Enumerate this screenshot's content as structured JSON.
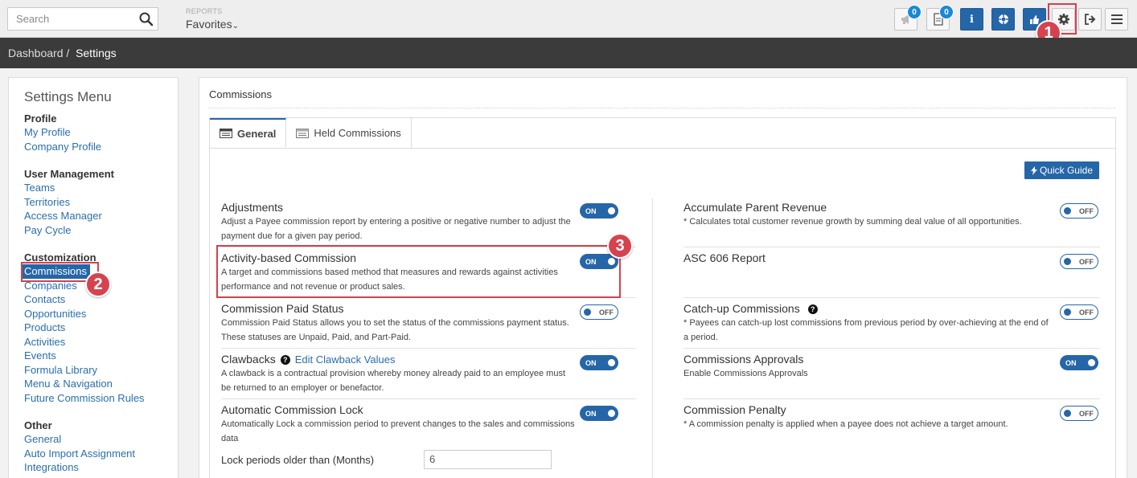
{
  "topbar": {
    "search_placeholder": "Search",
    "reports_label": "REPORTS",
    "favorites_label": "Favorites",
    "announcements_count": "0",
    "documents_count": "0"
  },
  "breadcrumb": {
    "root": "Dashboard",
    "sep": "/",
    "current": "Settings"
  },
  "sidebar": {
    "title": "Settings Menu",
    "groups": [
      {
        "title": "Profile",
        "items": [
          "My Profile",
          "Company Profile"
        ]
      },
      {
        "title": "User Management",
        "items": [
          "Teams",
          "Territories",
          "Access Manager",
          "Pay Cycle"
        ]
      },
      {
        "title": "Customization",
        "items": [
          "Commissions",
          "Companies",
          "Contacts",
          "Opportunities",
          "Products",
          "Activities",
          "Events",
          "Formula Library",
          "Menu & Navigation",
          "Future Commission Rules"
        ]
      },
      {
        "title": "Other",
        "items": [
          "General",
          "Auto Import Assignment",
          "Integrations"
        ]
      }
    ]
  },
  "main": {
    "title": "Commissions",
    "tabs": [
      "General",
      "Held Commissions"
    ],
    "quick_guide": "Quick Guide"
  },
  "settings_left": [
    {
      "title": "Adjustments",
      "desc": "Adjust a Payee commission report by entering a positive or negative number to adjust the payment due for a given pay period.",
      "state": "ON"
    },
    {
      "title": "Activity-based Commission",
      "desc": "A target and commissions based method that measures and rewards against activities performance and not revenue or product sales.",
      "state": "ON"
    },
    {
      "title": "Commission Paid Status",
      "desc": "Commission Paid Status allows you to set the status of the commissions payment status. These statuses are Unpaid, Paid, and Part-Paid.",
      "state": "OFF"
    },
    {
      "title": "Clawbacks",
      "link": "Edit Clawback Values",
      "desc": "A clawback is a contractual provision whereby money already paid to an employee must be returned to an employer or benefactor.",
      "state": "ON"
    },
    {
      "title": "Automatic Commission Lock",
      "desc": "Automatically Lock a commission period to prevent changes to the sales and commissions data",
      "state": "ON"
    }
  ],
  "lock": {
    "label": "Lock periods older than (Months)",
    "value": "6"
  },
  "settings_right": [
    {
      "title": "Accumulate Parent Revenue",
      "desc": "* Calculates total customer revenue growth by summing deal value of all opportunities.",
      "state": "OFF"
    },
    {
      "title": "ASC 606 Report",
      "desc": "",
      "state": "OFF"
    },
    {
      "title": "Catch-up Commissions",
      "desc": "* Payees can catch-up lost commissions from previous period by over-achieving at the end of a period.",
      "state": "OFF"
    },
    {
      "title": "Commissions Approvals",
      "desc": "Enable Commissions Approvals",
      "state": "ON"
    },
    {
      "title": "Commission Penalty",
      "desc": "* A commission penalty is applied when a payee does not achieve a target amount.",
      "state": "OFF"
    }
  ],
  "steps": [
    "1",
    "2",
    "3"
  ],
  "colors": {
    "primary": "#2566a8",
    "annotation": "#d3414f",
    "dark_bar": "#3b3b3b"
  }
}
